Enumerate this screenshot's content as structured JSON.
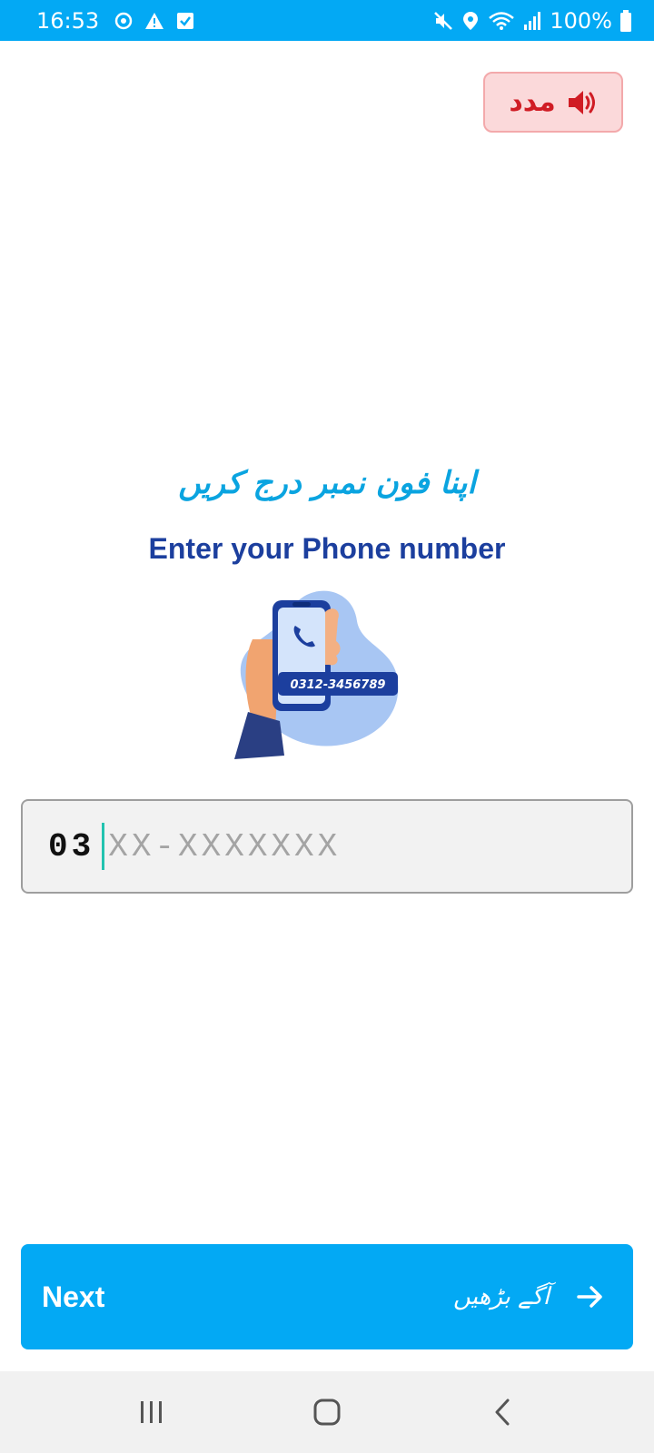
{
  "status_bar": {
    "time": "16:53",
    "battery": "100%",
    "left_icons": [
      "eye-comfort-icon",
      "warning-icon",
      "task-check-icon"
    ],
    "right_icons": [
      "mute-icon",
      "location-icon",
      "wifi-icon",
      "signal-icon",
      "battery-icon"
    ]
  },
  "help": {
    "label": "مدد",
    "icon": "speaker-icon",
    "color": "#d01c24"
  },
  "heading": {
    "urdu": "اپنا فون نمبر درج کریں",
    "english": "Enter your Phone number"
  },
  "illustration": {
    "number": "0312-3456789"
  },
  "phone_input": {
    "prefix": "03",
    "placeholder": "XX-XXXXXXX"
  },
  "next_button": {
    "label": "Next",
    "urdu_label": "آگے بڑھیں",
    "icon": "arrow-right-icon"
  },
  "nav_bar": {
    "buttons": [
      "recents-icon",
      "home-icon",
      "back-icon"
    ]
  },
  "colors": {
    "primary": "#03a9f4",
    "title_blue": "#1c3f9e",
    "urdu_title": "#0aa4e0",
    "help_bg": "#fbd9da"
  }
}
